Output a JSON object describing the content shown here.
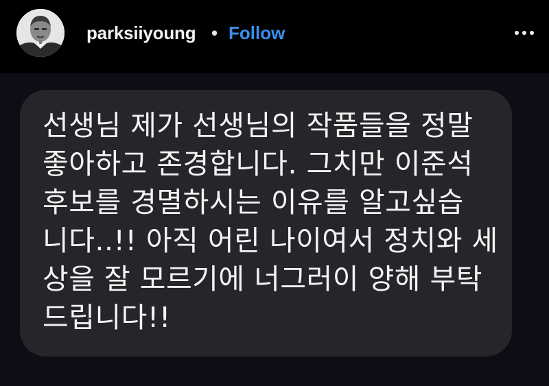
{
  "post": {
    "username": "parksiiyoung",
    "separator": "•",
    "follow_label": "Follow",
    "more_icon": "more-horizontal-icon",
    "avatar": "profile-photo"
  },
  "message": {
    "lines": [
      "선생님 제가 선생님의 작품들을 정말",
      "좋아하고 존경합니다. 그치만 이준석",
      "후보를 경멸하시는 이유를 알고싶습",
      "니다..!! 아직 어린 나이여서 정치와 세",
      "상을 잘 모르기에 너그러이 양해 부탁",
      "드립니다!!"
    ]
  },
  "colors": {
    "header_bg": "#000000",
    "page_bg": "#0d0e15",
    "bubble_bg": "#252629",
    "follow_accent": "#3a8ff0",
    "text": "#f3f3f3"
  }
}
